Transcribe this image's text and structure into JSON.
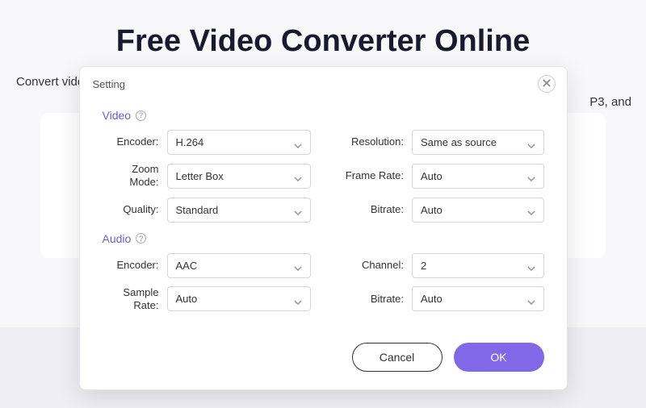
{
  "page": {
    "title": "Free Video Converter Online",
    "subtitle_left": "Convert video",
    "subtitle_right": "P3, and"
  },
  "modal": {
    "title": "Setting",
    "sections": {
      "video": {
        "label": "Video",
        "fields": {
          "encoder": {
            "label": "Encoder:",
            "value": "H.264"
          },
          "resolution": {
            "label": "Resolution:",
            "value": "Same as source"
          },
          "zoom_mode": {
            "label": "Zoom Mode:",
            "value": "Letter Box"
          },
          "frame_rate": {
            "label": "Frame Rate:",
            "value": "Auto"
          },
          "quality": {
            "label": "Quality:",
            "value": "Standard"
          },
          "bitrate": {
            "label": "Bitrate:",
            "value": "Auto"
          }
        }
      },
      "audio": {
        "label": "Audio",
        "fields": {
          "encoder": {
            "label": "Encoder:",
            "value": "AAC"
          },
          "channel": {
            "label": "Channel:",
            "value": "2"
          },
          "sample_rate": {
            "label": "Sample Rate:",
            "value": "Auto"
          },
          "bitrate": {
            "label": "Bitrate:",
            "value": "Auto"
          }
        }
      }
    },
    "buttons": {
      "cancel": "Cancel",
      "ok": "OK"
    }
  }
}
